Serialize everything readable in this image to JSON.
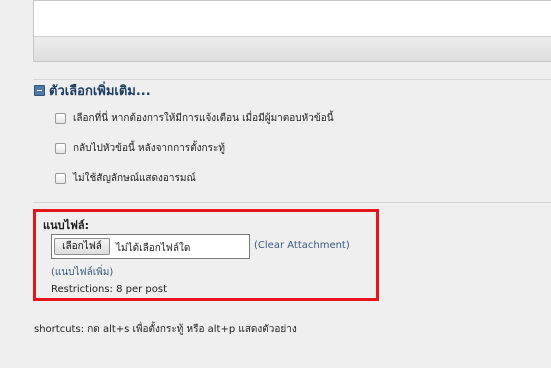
{
  "more_options": {
    "title": "ตัวเลือกเพิ่มเติม...",
    "options": [
      {
        "label": "เลือกที่นี่ หากต้องการให้มีการแจ้งเตือน เมื่อมีผู้มาตอบหัวข้อนี้",
        "checked": false
      },
      {
        "label": "กลับไปหัวข้อนี้ หลังจากการตั้งกระทู้",
        "checked": false
      },
      {
        "label": "ไม่ใช้สัญลักษณ์แสดงอารมณ์",
        "checked": false
      }
    ]
  },
  "attachments": {
    "title": "แนบไฟล์:",
    "choose_button": "เลือกไฟล์",
    "file_status": "ไม่ได้เลือกไฟล์ใด",
    "clear_link": "(Clear Attachment)",
    "add_more": "(แนบไฟล์เพิ่ม)",
    "restrictions": "Restrictions: 8 per post"
  },
  "shortcuts": "shortcuts: กด alt+s เพื่อตั้งกระทู้ หรือ alt+p แสดงตัวอย่าง",
  "colors": {
    "highlight_border": "#e4161c",
    "link": "#3b5a80",
    "header": "#1f3d63"
  }
}
